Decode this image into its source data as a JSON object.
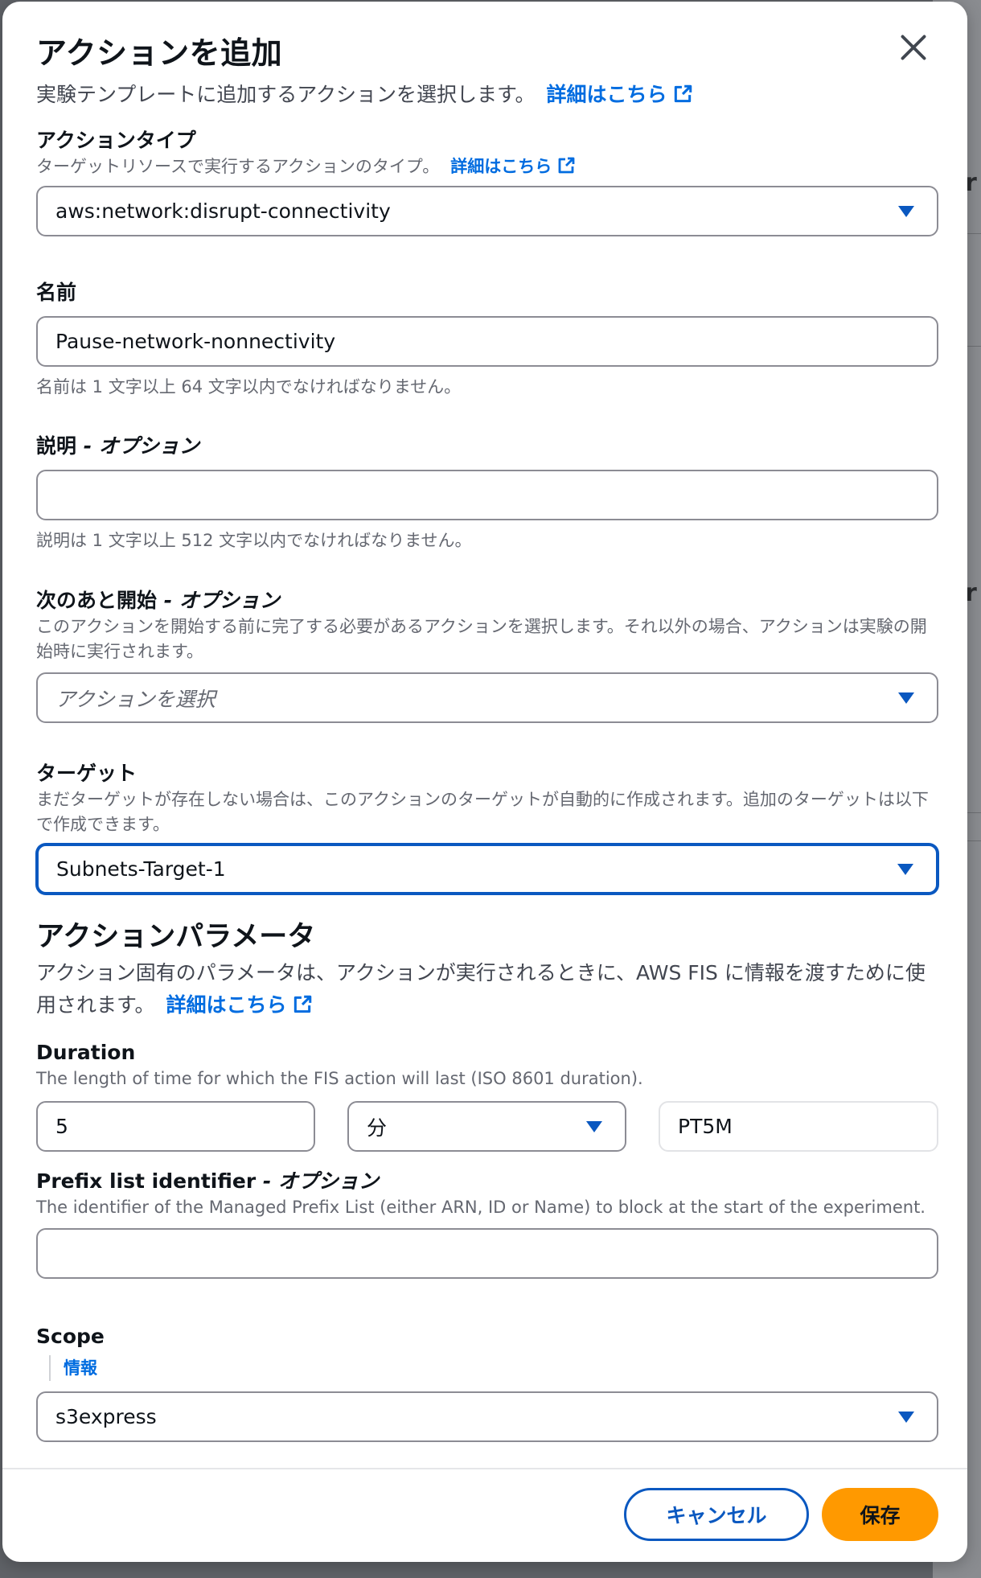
{
  "modal": {
    "title": "アクションを追加",
    "subtitle": "実験テンプレートに追加するアクションを選択します。",
    "learn_more": "詳細はこちら"
  },
  "action_type": {
    "label": "アクションタイプ",
    "desc": "ターゲットリソースで実行するアクションのタイプ。",
    "learn_more": "詳細はこちら",
    "value": "aws:network:disrupt-connectivity"
  },
  "name": {
    "label": "名前",
    "value": "Pause-network-nonnectivity",
    "hint": "名前は 1 文字以上 64 文字以内でなければなりません。"
  },
  "description": {
    "label": "説明",
    "optional": "- オプション",
    "value": "",
    "hint": "説明は 1 文字以上 512 文字以内でなければなりません。"
  },
  "start_after": {
    "label": "次のあと開始",
    "optional": "- オプション",
    "desc": "このアクションを開始する前に完了する必要があるアクションを選択します。それ以外の場合、アクションは実験の開始時に実行されます。",
    "placeholder": "アクションを選択"
  },
  "target": {
    "label": "ターゲット",
    "desc": "まだターゲットが存在しない場合は、このアクションのターゲットが自動的に作成されます。追加のターゲットは以下で作成できます。",
    "value": "Subnets-Target-1"
  },
  "action_params": {
    "title": "アクションパラメータ",
    "desc": "アクション固有のパラメータは、アクションが実行されるときに、AWS FIS に情報を渡すために使用されます。",
    "learn_more": "詳細はこちら"
  },
  "duration": {
    "label": "Duration",
    "desc": "The length of time for which the FIS action will last (ISO 8601 duration).",
    "value": "5",
    "unit": "分",
    "iso": "PT5M"
  },
  "prefix_list": {
    "label": "Prefix list identifier",
    "optional": "- オプション",
    "desc": "The identifier of the Managed Prefix List (either ARN, ID or Name) to block at the start of the experiment.",
    "value": ""
  },
  "scope": {
    "label": "Scope",
    "info": "情報",
    "value": "s3express"
  },
  "footer": {
    "cancel": "キャンセル",
    "save": "保存"
  },
  "colors": {
    "accent": "#0a58c0",
    "link": "#006ce0",
    "primary_button": "#ff9900"
  }
}
